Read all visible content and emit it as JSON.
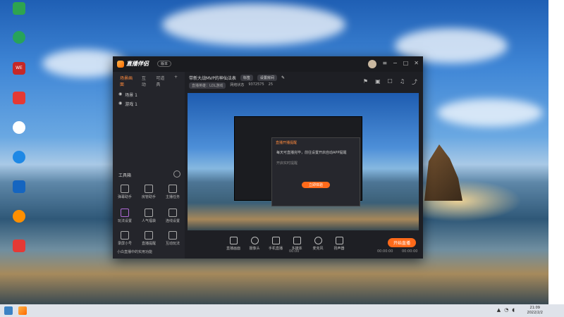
{
  "desktop_icons": [
    {
      "label": "",
      "color": "#2ea44f"
    },
    {
      "label": "",
      "color": "#27a35a"
    },
    {
      "label": "WE",
      "color": "#c62828"
    },
    {
      "label": "",
      "color": "#e53935"
    },
    {
      "label": "",
      "color": "#ffffff"
    },
    {
      "label": "",
      "color": "#1e88e5"
    },
    {
      "label": "",
      "color": "#1565c0"
    },
    {
      "label": "",
      "color": "#ff8f00"
    },
    {
      "label": "",
      "color": "#e53935"
    }
  ],
  "app": {
    "name": "直播伴侣",
    "version": "版本",
    "left_tabs": [
      "场景画面",
      "互动",
      "可道具"
    ],
    "scenes": [
      "场景 1",
      "游戏 1"
    ],
    "tools_title": "工具箱",
    "tools": [
      "弹幕助手",
      "房管助手",
      "主播任务",
      "玩法设置",
      "人气福袋",
      "连线设置",
      "录屏小号",
      "直播提醒",
      "互动玩法"
    ],
    "footer_note": "小白直播中的实用功能",
    "room_title": "带新大战MVP的神仙法表",
    "room_tag": "标签",
    "room_pill": "设置房间",
    "room_meta": [
      "直播英雄：LOL游戏",
      "网络状态",
      "9372575",
      "25"
    ],
    "controls": [
      "直播画面",
      "摄像头",
      "手机直播",
      "多媒体",
      "麦克风",
      "扬声器"
    ],
    "go_live": "开始直播",
    "popup_title": "直播开播提醒",
    "popup_text": "每天可直播完毕，前往设置开启自动APP提醒",
    "popup_link": "开启实时提醒",
    "popup_button": "立即体验",
    "stats": [
      "00:00",
      "00:00:00",
      "00:00:00"
    ]
  },
  "taskbar": {
    "time": "21:09",
    "date": "2022/2/2"
  }
}
